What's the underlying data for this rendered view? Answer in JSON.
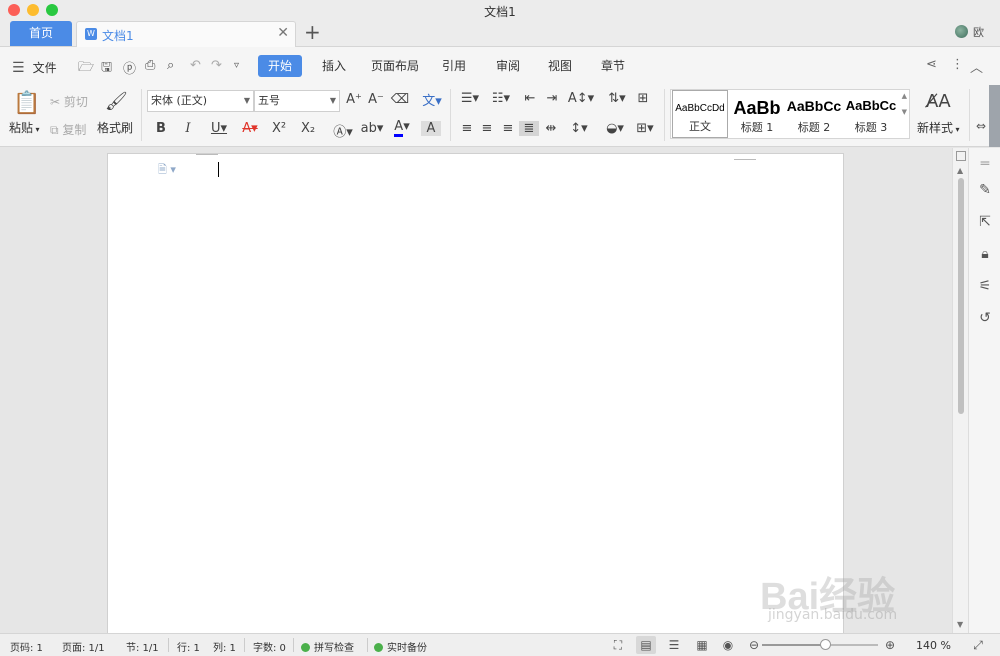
{
  "window": {
    "title": "文档1"
  },
  "tabs": {
    "home": "首页",
    "document": "文档1",
    "add": "+",
    "close": "✕",
    "user": "欧"
  },
  "menu": {
    "file": "文件",
    "ribbon_tabs": [
      "开始",
      "插入",
      "页面布局",
      "引用",
      "审阅",
      "视图",
      "章节"
    ],
    "active_tab": "开始"
  },
  "ribbon": {
    "paste": "粘贴",
    "cut": "剪切",
    "copy": "复制",
    "format_painter": "格式刷",
    "font_name": "宋体 (正文)",
    "font_size": "五号",
    "styles": [
      {
        "preview": "AaBbCcDd",
        "name": "正文"
      },
      {
        "preview": "AaBb",
        "name": "标题 1"
      },
      {
        "preview": "AaBbCc",
        "name": "标题 2"
      },
      {
        "preview": "AaBbCc",
        "name": "标题 3"
      }
    ],
    "new_style": "新样式",
    "colors": {
      "font_color_bar": "#0000ff",
      "font_underline_red": "#e0352b"
    }
  },
  "statusbar": {
    "page_num": "页码: 1",
    "pages": "页面: 1/1",
    "section": "节: 1/1",
    "row": "行: 1",
    "col": "列: 1",
    "word_count": "字数: 0",
    "spell_check": "拼写检查",
    "backup": "实时备份",
    "zoom": "140 %",
    "zoom_level": 0.55
  },
  "watermark": {
    "brand": "Bai经验",
    "url": "jingyan.baidu.com"
  },
  "accent_color": "#4b8be6"
}
